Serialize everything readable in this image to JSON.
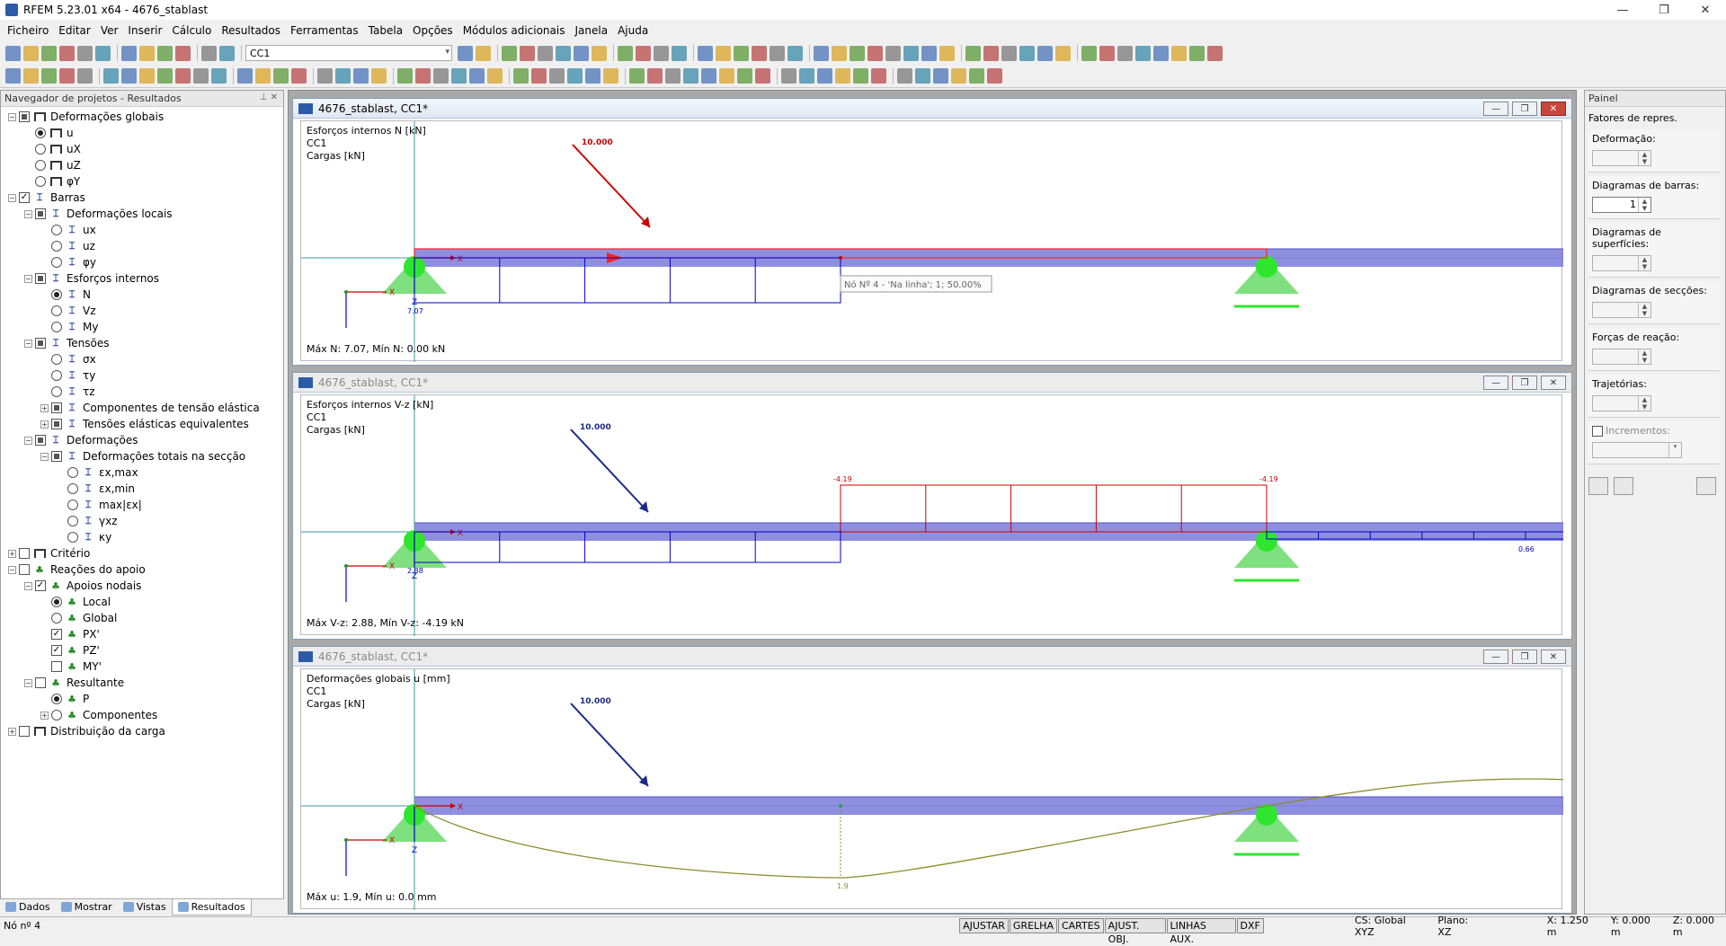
{
  "window": {
    "title": "RFEM 5.23.01 x64 - 4676_stablast",
    "minimize": "—",
    "restore": "❐",
    "close": "✕"
  },
  "menu": [
    "Ficheiro",
    "Editar",
    "Ver",
    "Inserir",
    "Cálculo",
    "Resultados",
    "Ferramentas",
    "Tabela",
    "Opções",
    "Módulos adicionais",
    "Janela",
    "Ajuda"
  ],
  "toolbar": {
    "load_case": "CC1"
  },
  "navigator": {
    "title": "Navegador de projetos - Resultados",
    "pin": "⊥ ✕",
    "items": [
      {
        "label": "Deformações globais",
        "lvl": 0,
        "exp": "−",
        "ctl": "chk-part",
        "ico": "frame"
      },
      {
        "label": "u",
        "lvl": 1,
        "exp": "",
        "ctl": "rad-on",
        "ico": "frame"
      },
      {
        "label": "uX",
        "lvl": 1,
        "exp": "",
        "ctl": "rad",
        "ico": "frame"
      },
      {
        "label": "uZ",
        "lvl": 1,
        "exp": "",
        "ctl": "rad",
        "ico": "frame"
      },
      {
        "label": "φY",
        "lvl": 1,
        "exp": "",
        "ctl": "rad",
        "ico": "frame"
      },
      {
        "label": "Barras",
        "lvl": 0,
        "exp": "−",
        "ctl": "chk-on",
        "ico": "beam"
      },
      {
        "label": "Deformações locais",
        "lvl": 1,
        "exp": "−",
        "ctl": "chk-part",
        "ico": "beam"
      },
      {
        "label": "ux",
        "lvl": 2,
        "exp": "",
        "ctl": "rad",
        "ico": "beam"
      },
      {
        "label": "uz",
        "lvl": 2,
        "exp": "",
        "ctl": "rad",
        "ico": "beam"
      },
      {
        "label": "φy",
        "lvl": 2,
        "exp": "",
        "ctl": "rad",
        "ico": "beam"
      },
      {
        "label": "Esforços internos",
        "lvl": 1,
        "exp": "−",
        "ctl": "chk-part",
        "ico": "beam"
      },
      {
        "label": "N",
        "lvl": 2,
        "exp": "",
        "ctl": "rad-on",
        "ico": "beam"
      },
      {
        "label": "Vz",
        "lvl": 2,
        "exp": "",
        "ctl": "rad",
        "ico": "beam"
      },
      {
        "label": "My",
        "lvl": 2,
        "exp": "",
        "ctl": "rad",
        "ico": "beam"
      },
      {
        "label": "Tensões",
        "lvl": 1,
        "exp": "−",
        "ctl": "chk-part",
        "ico": "beam"
      },
      {
        "label": "σx",
        "lvl": 2,
        "exp": "",
        "ctl": "rad",
        "ico": "beam"
      },
      {
        "label": "τy",
        "lvl": 2,
        "exp": "",
        "ctl": "rad",
        "ico": "beam"
      },
      {
        "label": "τz",
        "lvl": 2,
        "exp": "",
        "ctl": "rad",
        "ico": "beam"
      },
      {
        "label": "Componentes de tensão elástica",
        "lvl": 2,
        "exp": "+",
        "ctl": "chk-part",
        "ico": "beam"
      },
      {
        "label": "Tensões elásticas equivalentes",
        "lvl": 2,
        "exp": "+",
        "ctl": "chk-part",
        "ico": "beam"
      },
      {
        "label": "Deformações",
        "lvl": 1,
        "exp": "−",
        "ctl": "chk-part",
        "ico": "beam"
      },
      {
        "label": "Deformações totais na secção",
        "lvl": 2,
        "exp": "−",
        "ctl": "chk-part",
        "ico": "beam"
      },
      {
        "label": "εx,max",
        "lvl": 3,
        "exp": "",
        "ctl": "rad",
        "ico": "beam"
      },
      {
        "label": "εx,min",
        "lvl": 3,
        "exp": "",
        "ctl": "rad",
        "ico": "beam"
      },
      {
        "label": "max|εx|",
        "lvl": 3,
        "exp": "",
        "ctl": "rad",
        "ico": "beam"
      },
      {
        "label": "γxz",
        "lvl": 3,
        "exp": "",
        "ctl": "rad",
        "ico": "beam"
      },
      {
        "label": "κy",
        "lvl": 3,
        "exp": "",
        "ctl": "rad",
        "ico": "beam"
      },
      {
        "label": "Critério",
        "lvl": 0,
        "exp": "+",
        "ctl": "chk",
        "ico": "frame"
      },
      {
        "label": "Reações do apoio",
        "lvl": 0,
        "exp": "−",
        "ctl": "chk",
        "ico": "sup"
      },
      {
        "label": "Apoios nodais",
        "lvl": 1,
        "exp": "−",
        "ctl": "chk-on",
        "ico": "sup"
      },
      {
        "label": "Local",
        "lvl": 2,
        "exp": "",
        "ctl": "rad-on",
        "ico": "sup"
      },
      {
        "label": "Global",
        "lvl": 2,
        "exp": "",
        "ctl": "rad",
        "ico": "sup"
      },
      {
        "label": "PX'",
        "lvl": 2,
        "exp": "",
        "ctl": "chk-on",
        "ico": "sup"
      },
      {
        "label": "PZ'",
        "lvl": 2,
        "exp": "",
        "ctl": "chk-on",
        "ico": "sup"
      },
      {
        "label": "MY'",
        "lvl": 2,
        "exp": "",
        "ctl": "chk",
        "ico": "sup"
      },
      {
        "label": "Resultante",
        "lvl": 1,
        "exp": "−",
        "ctl": "chk",
        "ico": "sup"
      },
      {
        "label": "P",
        "lvl": 2,
        "exp": "",
        "ctl": "rad-on",
        "ico": "sup"
      },
      {
        "label": "Componentes",
        "lvl": 2,
        "exp": "+",
        "ctl": "rad",
        "ico": "sup"
      },
      {
        "label": "Distribuição da carga",
        "lvl": 0,
        "exp": "+",
        "ctl": "chk",
        "ico": "frame"
      }
    ],
    "tabs": [
      "Dados",
      "Mostrar",
      "Vistas",
      "Resultados"
    ]
  },
  "windows": [
    {
      "title": "4676_stablast, CC1*",
      "lines": [
        "Esforços internos N [kN]",
        "CC1",
        "Cargas [kN]"
      ],
      "load": "10.000",
      "tooltip": "Nó Nº 4 - 'Na linha'; 1; 50.00%",
      "val_a": "7.07",
      "val_b": "",
      "val_c": "",
      "footer": "Máx N: 7.07, Mín N: 0.00 kN"
    },
    {
      "title": "4676_stablast, CC1*",
      "lines": [
        "Esforços internos V-z [kN]",
        "CC1",
        "Cargas [kN]"
      ],
      "load": "10.000",
      "tooltip": "",
      "val_a": "2.88",
      "val_b": "-4.19",
      "val_c": "0.66",
      "footer": "Máx V-z: 2.88, Mín V-z: -4.19 kN"
    },
    {
      "title": "4676_stablast, CC1*",
      "lines": [
        "Deformações globais u [mm]",
        "CC1",
        "Cargas [kN]"
      ],
      "load": "10.000",
      "tooltip": "",
      "val_a": "1.9",
      "val_b": "",
      "val_c": "",
      "footer": "Máx u: 1.9, Mín u: 0.0 mm"
    }
  ],
  "axis_labels": {
    "x": "X",
    "z": "Z"
  },
  "panel": {
    "title": "Painel",
    "heading": "Fatores de repres.",
    "groups": [
      {
        "label": "Deformação:",
        "value": ""
      },
      {
        "label": "Diagramas de barras:",
        "value": "1"
      },
      {
        "label": "Diagramas de superfícies:",
        "value": ""
      },
      {
        "label": "Diagramas de secções:",
        "value": ""
      },
      {
        "label": "Forças de reação:",
        "value": ""
      },
      {
        "label": "Trajetórias:",
        "value": ""
      }
    ],
    "increments": "Incrementos:"
  },
  "status": {
    "left": "Nó nº 4",
    "buttons": [
      "AJUSTAR",
      "GRELHA",
      "CARTES",
      "AJUST. OBJ.",
      "LINHAS AUX.",
      "DXF"
    ],
    "cs": "CS: Global XYZ",
    "plane": "Plano: XZ",
    "x": "X:  1.250 m",
    "y": "Y:  0.000 m",
    "z": "Z:  0.000 m"
  },
  "colors": {
    "beam": "#7b7bdb",
    "support": "#2ee62e",
    "diagram": "#0000cc",
    "load": "#cc0000",
    "highlight": "#ff2222",
    "deform": "#8b8b2b",
    "accent": "#2c5ca8"
  }
}
